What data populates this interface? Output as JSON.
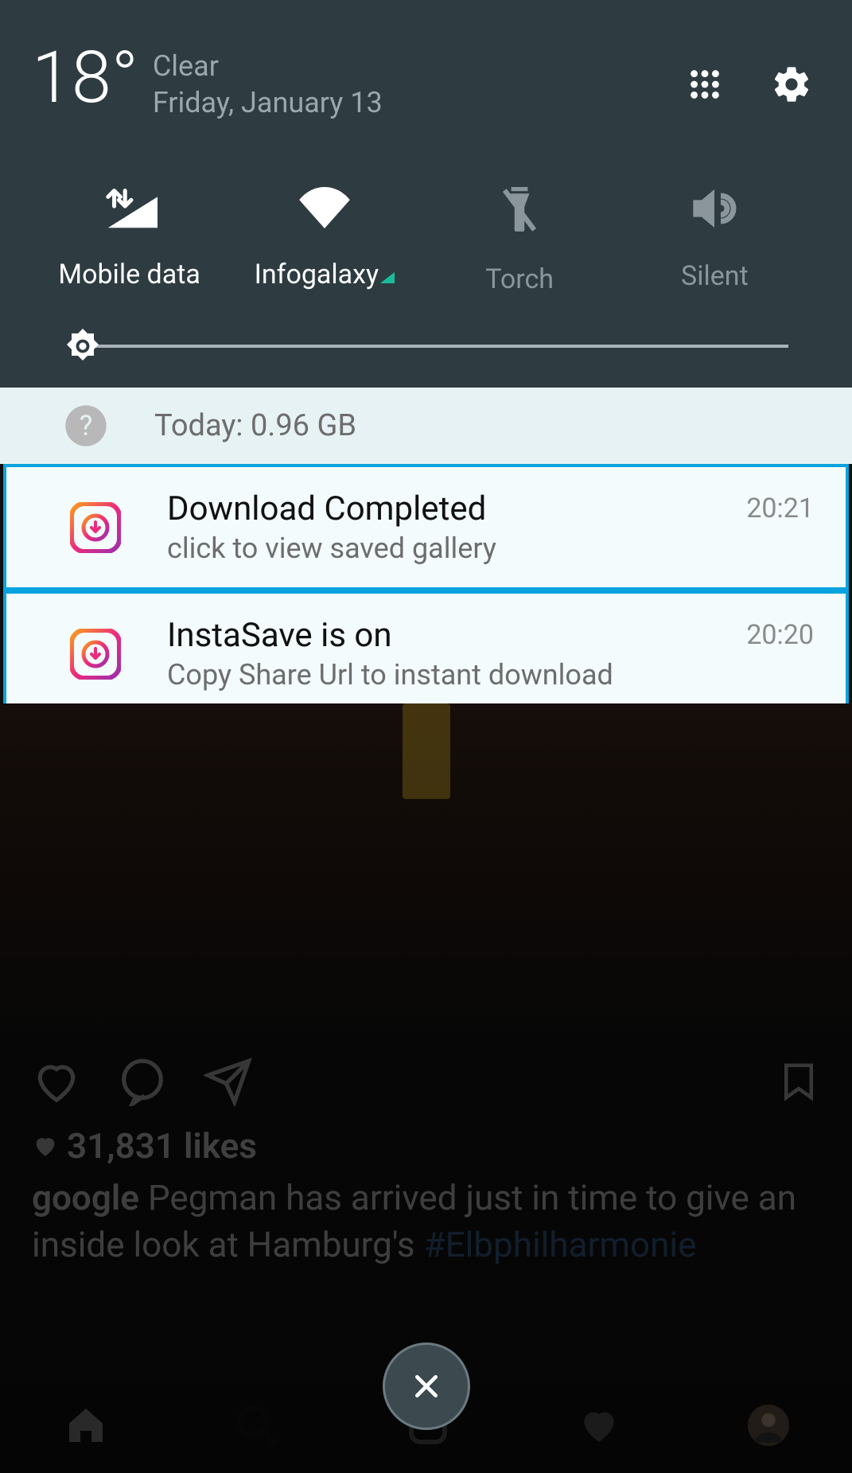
{
  "header": {
    "temperature": "18°",
    "condition": "Clear",
    "date": "Friday, January 13"
  },
  "quick_settings": {
    "tiles": [
      {
        "label": "Mobile data",
        "active": true
      },
      {
        "label": "Infogalaxy",
        "active": true
      },
      {
        "label": "Torch",
        "active": false
      },
      {
        "label": "Silent",
        "active": false
      }
    ]
  },
  "usage": {
    "text": "Today: 0.96 GB"
  },
  "notifications": [
    {
      "title": "Download Completed",
      "subtitle": "click to view saved gallery",
      "time": "20:21",
      "icon": "instasave-icon"
    },
    {
      "title": "InstaSave is on",
      "subtitle": "Copy Share Url to instant download",
      "time": "20:20",
      "icon": "instasave-icon"
    }
  ],
  "post": {
    "likes_count": "31,831 likes",
    "username": "google",
    "caption_prefix": " Pegman has arrived just in time to give an inside look at Hamburg's ",
    "caption_mid": "   ",
    "hashtag": "#Elbphilharmonie"
  }
}
